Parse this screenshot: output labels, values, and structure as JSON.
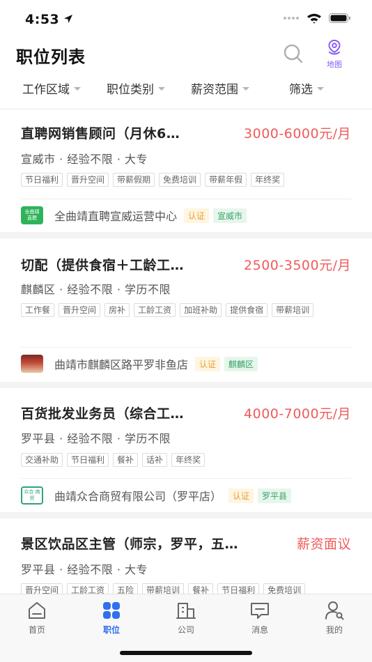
{
  "status": {
    "time": "4:53"
  },
  "header": {
    "title": "职位列表",
    "map_label": "地图"
  },
  "filters": [
    {
      "label": "工作区域"
    },
    {
      "label": "职位类别"
    },
    {
      "label": "薪资范围"
    },
    {
      "label": "筛选"
    }
  ],
  "jobs": [
    {
      "title": "直聘网销售顾问（月休6…",
      "salary": "3000-6000元/月",
      "meta": "宣威市 · 经验不限 · 大专",
      "tags": [
        "节日福利",
        "晋升空间",
        "带薪假期",
        "免费培训",
        "带薪年假",
        "年终奖"
      ],
      "company": "全曲靖直聘宣威运营中心",
      "cert": "认证",
      "area": "宣威市",
      "logo_text": "全曲靖 直聘"
    },
    {
      "title": "切配（提供食宿＋工龄工…",
      "salary": "2500-3500元/月",
      "meta": "麒麟区 · 经验不限 · 学历不限",
      "tags": [
        "工作餐",
        "晋升空间",
        "房补",
        "工龄工资",
        "加班补助",
        "提供食宿",
        "带薪培训"
      ],
      "company": "曲靖市麒麟区路平罗非鱼店",
      "cert": "认证",
      "area": "麒麟区"
    },
    {
      "title": "百货批发业务员（综合工…",
      "salary": "4000-7000元/月",
      "meta": "罗平县 · 经验不限 · 学历不限",
      "tags": [
        "交通补助",
        "节日福利",
        "餐补",
        "话补",
        "年终奖"
      ],
      "company": "曲靖众合商贸有限公司（罗平店）",
      "cert": "认证",
      "area": "罗平县",
      "logo_text": "众合 商贸"
    },
    {
      "title": "景区饮品区主管（师宗，罗平，五…",
      "salary": "薪资面议",
      "meta": "罗平县 · 经验不限 · 大专",
      "tags": [
        "晋升空间",
        "工龄工资",
        "五险",
        "带薪培训",
        "餐补",
        "节日福利",
        "免费培训"
      ]
    }
  ],
  "tabs": [
    {
      "label": "首页",
      "active": false
    },
    {
      "label": "职位",
      "active": true
    },
    {
      "label": "公司",
      "active": false
    },
    {
      "label": "消息",
      "active": false
    },
    {
      "label": "我的",
      "active": false
    }
  ],
  "colors": {
    "accent": "#2f6ff0",
    "salary": "#f05a5a",
    "map": "#8a5cf5",
    "cert": "#e0a23a",
    "area": "#3aa46c"
  }
}
